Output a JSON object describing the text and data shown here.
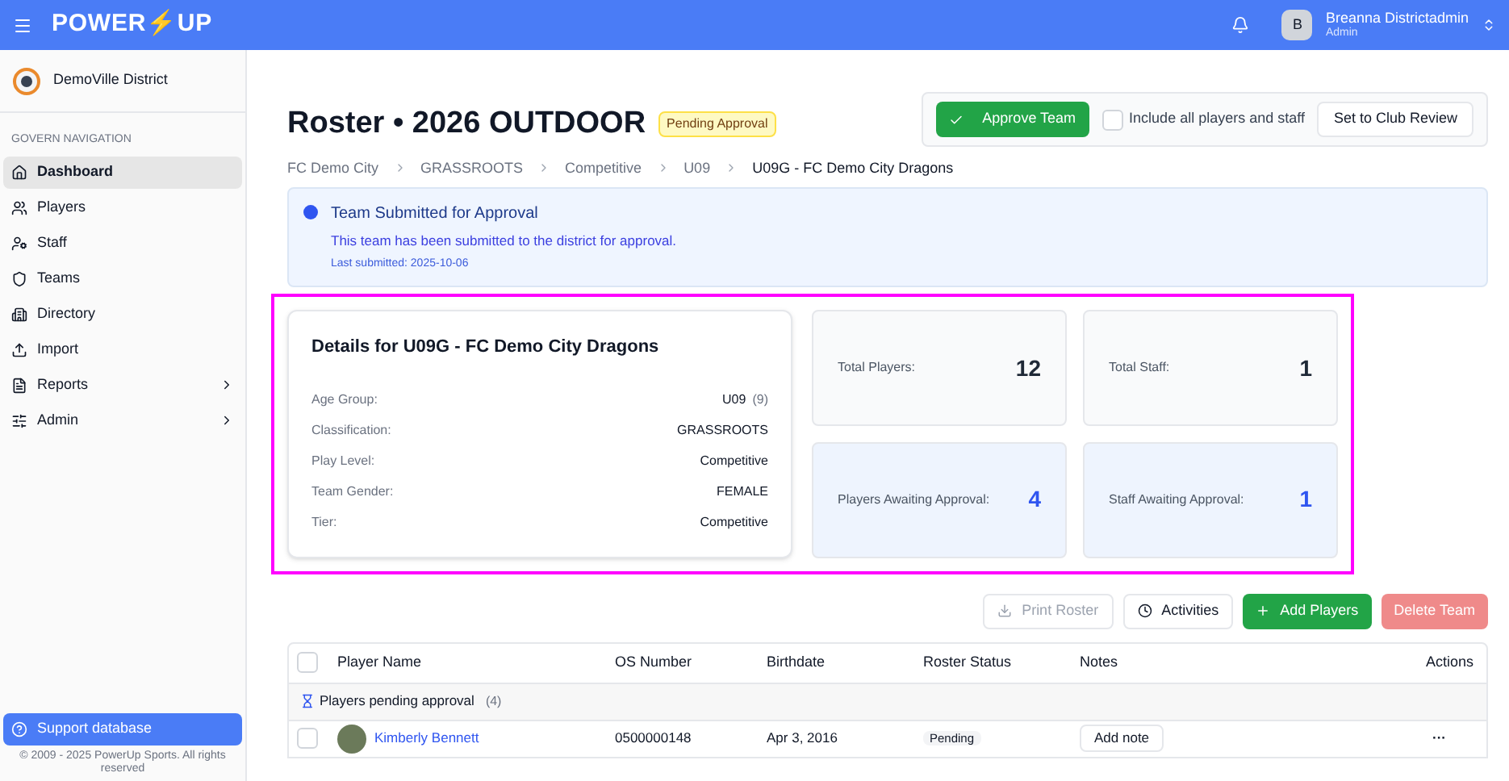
{
  "topbar": {
    "logo": "POWER⚡UP",
    "user": {
      "initial": "B",
      "name": "Breanna Districtadmin",
      "role": "Admin"
    }
  },
  "sidebar": {
    "org": "DemoVille District",
    "section": "GOVERN NAVIGATION",
    "items": [
      {
        "label": "Dashboard",
        "kind": "link",
        "selected": true
      },
      {
        "label": "Players",
        "kind": "link",
        "selected": false
      },
      {
        "label": "Staff",
        "kind": "link",
        "selected": false
      },
      {
        "label": "Teams",
        "kind": "link",
        "selected": false
      },
      {
        "label": "Directory",
        "kind": "link",
        "selected": false
      },
      {
        "label": "Import",
        "kind": "link",
        "selected": false
      },
      {
        "label": "Reports",
        "kind": "group",
        "selected": false
      },
      {
        "label": "Admin",
        "kind": "group",
        "selected": false
      }
    ],
    "support": "Support database",
    "copyright": "© 2009 - 2025 PowerUp Sports. All rights reserved"
  },
  "header": {
    "title": "Roster • 2026 OUTDOOR",
    "badge": "Pending Approval",
    "approve": "Approve Team",
    "include": {
      "label": "Include all players and staff",
      "checked": false
    },
    "club_review": "Set to Club Review"
  },
  "breadcrumb": [
    "FC Demo City",
    "GRASSROOTS",
    "Competitive",
    "U09",
    "U09G - FC Demo City Dragons"
  ],
  "alert": {
    "title": "Team Submitted for Approval",
    "message": "This team has been submitted to the district for approval.",
    "meta": "Last submitted: 2025-10-06"
  },
  "details": {
    "title": "Details for U09G - FC Demo City Dragons",
    "fields": [
      {
        "label": "Age Group:",
        "value": "U09",
        "extra": "(9)"
      },
      {
        "label": "Classification:",
        "value": "GRASSROOTS"
      },
      {
        "label": "Play Level:",
        "value": "Competitive"
      },
      {
        "label": "Team Gender:",
        "value": "FEMALE"
      },
      {
        "label": "Tier:",
        "value": "Competitive"
      }
    ]
  },
  "stats": [
    {
      "label": "Total Players:",
      "value": "12",
      "kind": "total"
    },
    {
      "label": "Total Staff:",
      "value": "1",
      "kind": "total"
    },
    {
      "label": "Players Awaiting Approval:",
      "value": "4",
      "kind": "awaiting"
    },
    {
      "label": "Staff Awaiting Approval:",
      "value": "1",
      "kind": "awaiting"
    }
  ],
  "actions": [
    {
      "label": "Print Roster",
      "kind": "outline",
      "disabled": true
    },
    {
      "label": "Activities",
      "kind": "outline",
      "disabled": false
    },
    {
      "label": "Add Players",
      "kind": "primary",
      "disabled": false
    },
    {
      "label": "Delete Team",
      "kind": "danger",
      "disabled": true
    }
  ],
  "table": {
    "select_all": {
      "checked": false
    },
    "columns": [
      "Player Name",
      "OS Number",
      "Birthdate",
      "Roster Status",
      "Notes",
      "Actions"
    ],
    "group": {
      "label": "Players pending approval",
      "count": "(4)"
    },
    "rows": [
      {
        "name": "Kimberly Bennett",
        "os_number": "0500000148",
        "birthdate": "Apr 3, 2016",
        "status": "Pending",
        "notes_button": "Add note",
        "menu": "···",
        "checked": false
      }
    ]
  }
}
